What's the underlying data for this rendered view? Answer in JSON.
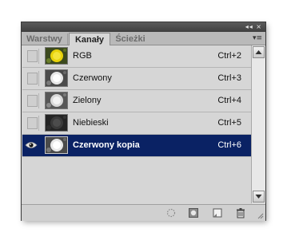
{
  "panel": {
    "titlebar_controls": "◂◂ ×",
    "tabs": [
      {
        "label": "Warstwy",
        "active": false
      },
      {
        "label": "Kanały",
        "active": true
      },
      {
        "label": "Ścieżki",
        "active": false
      }
    ],
    "menu_icon": "panel-menu-icon"
  },
  "channels": [
    {
      "name": "RGB",
      "shortcut": "Ctrl+2",
      "thumbnail": "color",
      "visible": false,
      "selected": false
    },
    {
      "name": "Czerwony",
      "shortcut": "Ctrl+3",
      "thumbnail": "grayscale",
      "visible": false,
      "selected": false
    },
    {
      "name": "Zielony",
      "shortcut": "Ctrl+4",
      "thumbnail": "grayscale",
      "visible": false,
      "selected": false
    },
    {
      "name": "Niebieski",
      "shortcut": "Ctrl+5",
      "thumbnail": "dark-grayscale",
      "visible": false,
      "selected": false
    },
    {
      "name": "Czerwony kopia",
      "shortcut": "Ctrl+6",
      "thumbnail": "grayscale",
      "visible": true,
      "selected": true
    }
  ],
  "footer_icons": [
    "load-selection-icon",
    "save-selection-icon",
    "new-channel-icon",
    "delete-channel-icon"
  ],
  "colors": {
    "selection": "#0a2264",
    "panel_bg": "#d6d6d6",
    "titlebar": "#4a4a4a"
  }
}
